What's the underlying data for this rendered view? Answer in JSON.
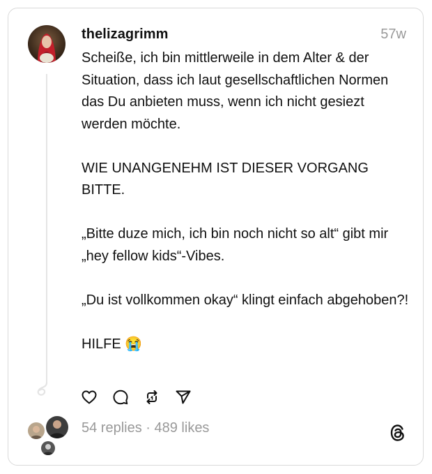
{
  "post": {
    "username": "thelizagrimm",
    "time": "57w",
    "text": "Scheiße, ich bin mittlerweile in dem Alter & der Situation, dass ich laut gesellschaftlichen Normen das Du anbieten muss, wenn ich nicht gesiezt werden möchte.\n\nWIE UNANGENEHM IST DIESER VORGANG BITTE.\n\n„Bitte duze mich, ich bin noch nicht so alt“ gibt mir „hey fellow kids“-Vibes.\n\n„Du ist vollkommen okay“ klingt einfach abgehoben?!\n\nHILFE 😭"
  },
  "actions": [
    {
      "name": "like",
      "icon": "heart-icon"
    },
    {
      "name": "reply",
      "icon": "comment-icon"
    },
    {
      "name": "repost",
      "icon": "repost-icon"
    },
    {
      "name": "share",
      "icon": "send-icon"
    }
  ],
  "stats": {
    "replies": "54 replies",
    "separator": " · ",
    "likes": "489 likes"
  },
  "colors": {
    "text": "#101010",
    "muted": "#999999",
    "border": "#d9d9d9"
  }
}
